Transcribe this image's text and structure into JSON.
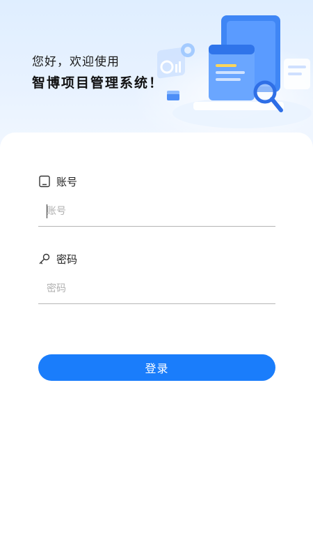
{
  "header": {
    "greeting": "您好，欢迎使用",
    "system_name": "智博项目管理系统！"
  },
  "form": {
    "account": {
      "label": "账号",
      "placeholder": "账号",
      "value": "",
      "icon": "phone-icon"
    },
    "password": {
      "label": "密码",
      "placeholder": "密码",
      "value": "",
      "icon": "key-icon"
    },
    "login_label": "登录"
  },
  "colors": {
    "accent": "#1a7dfb",
    "banner_top": "#dfeeff",
    "text_primary": "#111111",
    "divider": "#b5b5b5",
    "placeholder": "#b0b0b0"
  }
}
